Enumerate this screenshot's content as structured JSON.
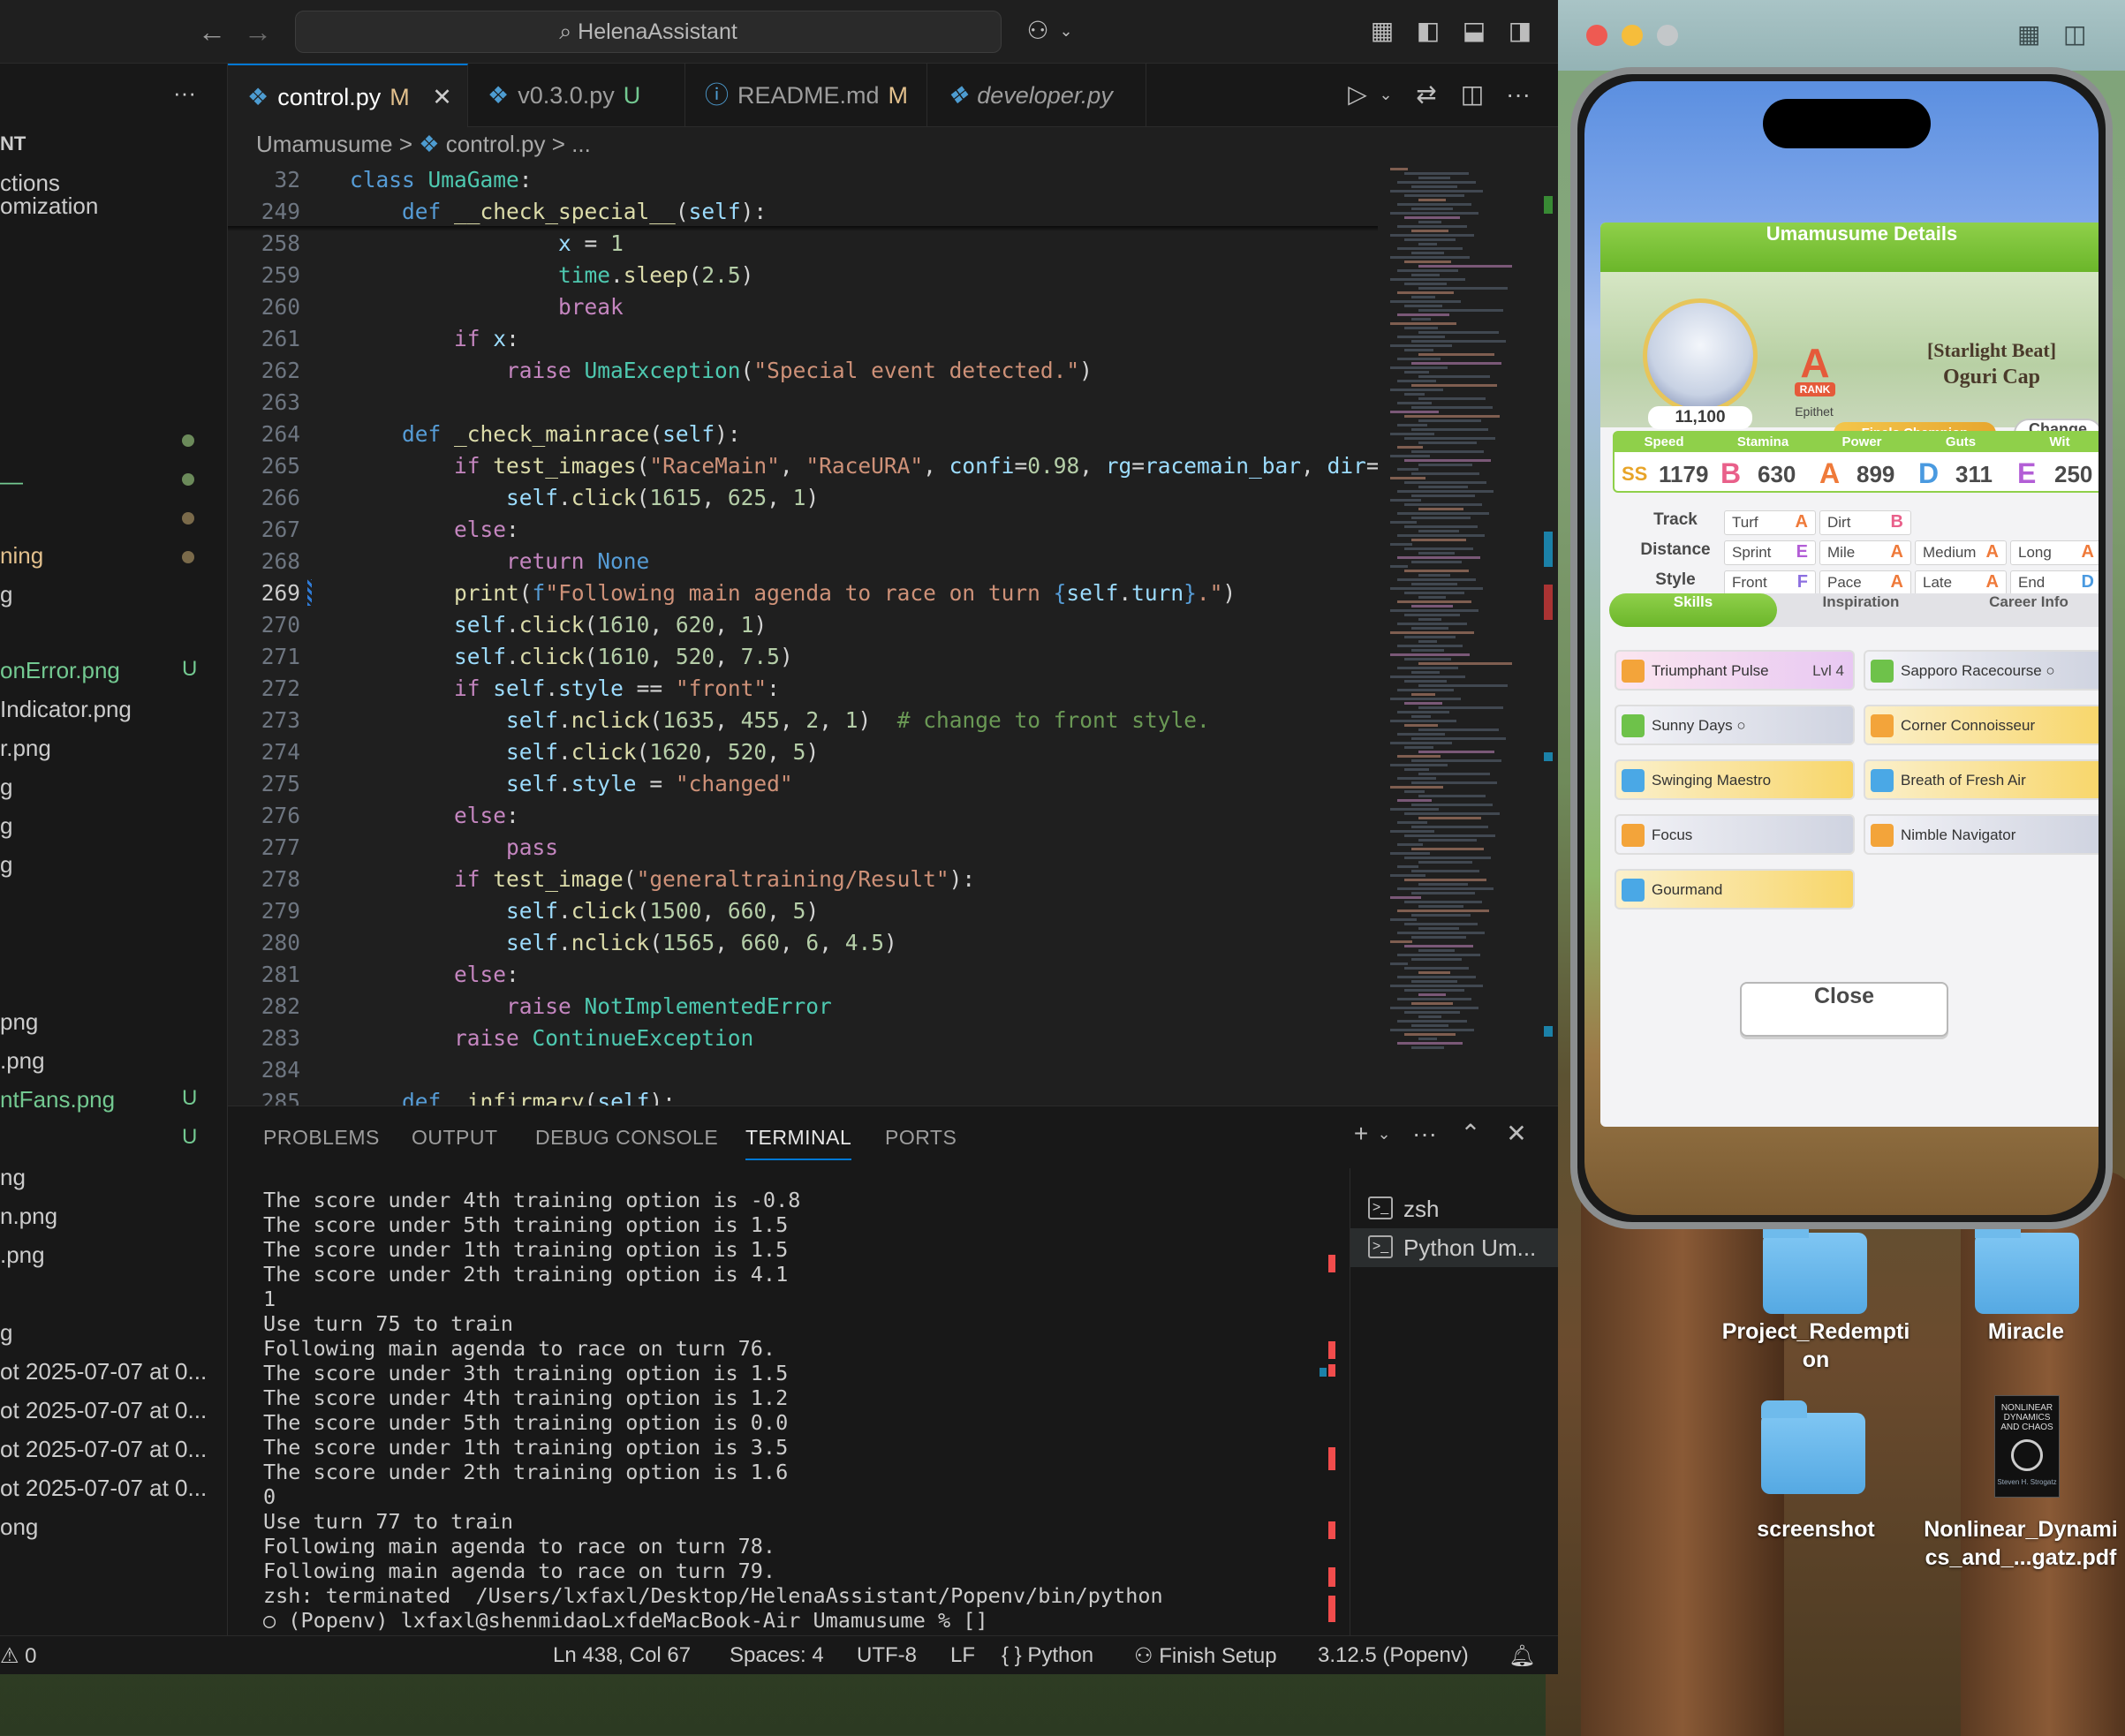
{
  "vscode": {
    "search_text": "HelenaAssistant",
    "sidebar": {
      "header": "NT",
      "items": [
        "ctions",
        "omization",
        "—",
        "ning",
        "g",
        "onError.png",
        "Indicator.png",
        "r.png",
        "g",
        "g",
        "g",
        "png",
        ".png",
        "ntFans.png",
        "ng",
        "n.png",
        ".png",
        "g",
        "ot 2025-07-07 at 0...",
        "ot 2025-07-07 at 0...",
        "ot 2025-07-07 at 0...",
        "ot 2025-07-07 at 0...",
        "ong"
      ],
      "badges": {
        "onError": "U",
        "ntFans": "U",
        "blank": "U"
      }
    },
    "tabs": [
      {
        "label": "control.py",
        "status": "M"
      },
      {
        "label": "v0.3.0.py",
        "status": "U"
      },
      {
        "label": "README.md",
        "status": "M"
      },
      {
        "label": "developer.py",
        "status": ""
      }
    ],
    "breadcrumb": {
      "folder": "Umamusume",
      "file": "control.py",
      "more": "..."
    },
    "code_lines": [
      {
        "num": "32"
      },
      {
        "num": "249"
      },
      {
        "num": "258"
      },
      {
        "num": "259"
      },
      {
        "num": "260"
      },
      {
        "num": "261"
      },
      {
        "num": "262"
      },
      {
        "num": "263"
      },
      {
        "num": "264"
      },
      {
        "num": "265"
      },
      {
        "num": "266"
      },
      {
        "num": "267"
      },
      {
        "num": "268"
      },
      {
        "num": "269"
      },
      {
        "num": "270"
      },
      {
        "num": "271"
      },
      {
        "num": "272"
      },
      {
        "num": "273"
      },
      {
        "num": "274"
      },
      {
        "num": "275"
      },
      {
        "num": "276"
      },
      {
        "num": "277"
      },
      {
        "num": "278"
      },
      {
        "num": "279"
      },
      {
        "num": "280"
      },
      {
        "num": "281"
      },
      {
        "num": "282"
      },
      {
        "num": "283"
      },
      {
        "num": "284"
      },
      {
        "num": "285"
      }
    ],
    "panel_tabs": [
      "PROBLEMS",
      "OUTPUT",
      "DEBUG CONSOLE",
      "TERMINAL",
      "PORTS"
    ],
    "terminal_lines": [
      "The score under 4th training option is -0.8",
      "The score under 5th training option is 1.5",
      "The score under 1th training option is 1.5",
      "The score under 2th training option is 4.1",
      "1",
      "Use turn 75 to train",
      "Following main agenda to race on turn 76.",
      "The score under 3th training option is 1.5",
      "The score under 4th training option is 1.2",
      "The score under 5th training option is 0.0",
      "The score under 1th training option is 3.5",
      "The score under 2th training option is 1.6",
      "0",
      "Use turn 77 to train",
      "Following main agenda to race on turn 78.",
      "Following main agenda to race on turn 79.",
      "zsh: terminated  /Users/lxfaxl/Desktop/HelenaAssistant/Popenv/bin/python",
      "○ (Popenv) lxfaxl@shenmidaoLxfdeMacBook-Air Umamusume % []"
    ],
    "terminal_sessions": [
      "zsh",
      "Python  Um..."
    ],
    "status": {
      "problems": "⚠ 0",
      "position": "Ln 438, Col 67",
      "spaces": "Spaces: 4",
      "encoding": "UTF-8",
      "eol": "LF",
      "language": "{ } Python",
      "setup": "Finish Setup",
      "interpreter": "3.12.5 (Popenv)"
    }
  },
  "game": {
    "header": "Umamusume Details",
    "fans": "11,100",
    "rank_letter": "A",
    "rank_label": "RANK",
    "epithet": "Epithet",
    "title": "[Starlight Beat]",
    "name": "Oguri Cap",
    "badge": "Finals Champion",
    "change_label": "Change",
    "stats": [
      {
        "name": "Speed",
        "grade": "SS",
        "value": "1179",
        "color": "#e8a428"
      },
      {
        "name": "Stamina",
        "grade": "B",
        "value": "630",
        "color": "#e9608a"
      },
      {
        "name": "Power",
        "grade": "A",
        "value": "899",
        "color": "#ef7a3a"
      },
      {
        "name": "Guts",
        "grade": "D",
        "value": "311",
        "color": "#4a9ae0"
      },
      {
        "name": "Wit",
        "grade": "E",
        "value": "250",
        "color": "#b35ed6"
      }
    ],
    "aptitude": {
      "track_label": "Track",
      "distance_label": "Distance",
      "style_label": "Style",
      "track": [
        {
          "n": "Turf",
          "g": "A"
        },
        {
          "n": "Dirt",
          "g": "B"
        }
      ],
      "distance": [
        {
          "n": "Sprint",
          "g": "E"
        },
        {
          "n": "Mile",
          "g": "A"
        },
        {
          "n": "Medium",
          "g": "A"
        },
        {
          "n": "Long",
          "g": "A"
        }
      ],
      "style": [
        {
          "n": "Front",
          "g": "F"
        },
        {
          "n": "Pace",
          "g": "A"
        },
        {
          "n": "Late",
          "g": "A"
        },
        {
          "n": "End",
          "g": "D"
        }
      ]
    },
    "tabs": [
      "Skills",
      "Inspiration",
      "Career Info"
    ],
    "skills": [
      {
        "name": "Triumphant Pulse",
        "level": "Lvl 4"
      },
      {
        "name": "Sapporo Racecourse ○",
        "level": ""
      },
      {
        "name": "Sunny Days ○",
        "level": ""
      },
      {
        "name": "Corner Connoisseur",
        "level": ""
      },
      {
        "name": "Swinging Maestro",
        "level": ""
      },
      {
        "name": "Breath of Fresh Air",
        "level": ""
      },
      {
        "name": "Focus",
        "level": ""
      },
      {
        "name": "Nimble Navigator",
        "level": ""
      },
      {
        "name": "Gourmand",
        "level": ""
      }
    ],
    "close_label": "Close"
  },
  "desktop": {
    "items": [
      "Project_Redemption",
      "Miracle",
      "screenshot",
      "Nonlinear_Dynamics_and_...gatz.pdf"
    ],
    "pdf_cover": [
      "NONLINEAR",
      "DYNAMICS",
      "AND CHAOS",
      "Steven H. Strogatz"
    ]
  }
}
